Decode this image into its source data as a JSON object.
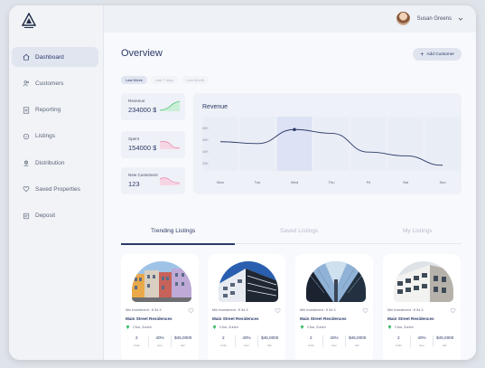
{
  "user": {
    "name": "Susan Greens"
  },
  "sidebar": {
    "items": [
      {
        "label": "Dashboard",
        "icon": "home-icon",
        "active": true
      },
      {
        "label": "Customers",
        "icon": "users-icon",
        "active": false
      },
      {
        "label": "Reporting",
        "icon": "report-icon",
        "active": false
      },
      {
        "label": "Listings",
        "icon": "listings-icon",
        "active": false
      },
      {
        "label": "Distribution",
        "icon": "distribution-icon",
        "active": false
      },
      {
        "label": "Saved Properties",
        "icon": "heart-icon",
        "active": false
      },
      {
        "label": "Deposit",
        "icon": "deposit-icon",
        "active": false
      }
    ]
  },
  "main": {
    "title": "Overview",
    "add_button": "Add Customer",
    "filters": [
      "Last Week",
      "Last 7 days",
      "Last Month"
    ],
    "stats": [
      {
        "label": "Revenue",
        "value": "234000 $",
        "trend_color": "#4cc27a"
      },
      {
        "label": "Spent",
        "value": "154000 $",
        "trend_color": "#e78fb3"
      },
      {
        "label": "New Customers",
        "value": "123",
        "trend_color": "#e78fb3"
      }
    ],
    "tabs": [
      "Trending Listings",
      "Saved Listings",
      "My Listings"
    ]
  },
  "chart_data": {
    "type": "line",
    "title": "Revenue",
    "categories": [
      "Mon",
      "Tue",
      "Wed",
      "Thu",
      "Fri",
      "Sat",
      "Sun"
    ],
    "y_ticks": [
      "80K",
      "60K",
      "40K",
      "20K"
    ],
    "values": [
      62,
      58,
      88,
      80,
      40,
      32,
      12
    ],
    "ylim": [
      0,
      100
    ],
    "highlight_category": "Wed",
    "line_color": "#2b3a67"
  },
  "listings": [
    {
      "min_investment": "Min Investment : ¥ 54.3",
      "name": "Main Street Residences",
      "location": "Chur, Zurich",
      "metrics": [
        {
          "value": "2",
          "label": "Units"
        },
        {
          "value": "40%",
          "label": "Gen"
        },
        {
          "value": "$45,0000",
          "label": "Etc"
        }
      ]
    },
    {
      "min_investment": "Min Investment : ¥ 54.3",
      "name": "Main Street Residences",
      "location": "Chur, Zurich",
      "metrics": [
        {
          "value": "2",
          "label": "Units"
        },
        {
          "value": "40%",
          "label": "Gen"
        },
        {
          "value": "$45,0000",
          "label": "Etc"
        }
      ]
    },
    {
      "min_investment": "Min Investment : ¥ 54.3",
      "name": "Main Street Residences",
      "location": "Chur, Zurich",
      "metrics": [
        {
          "value": "2",
          "label": "Units"
        },
        {
          "value": "40%",
          "label": "Gen"
        },
        {
          "value": "$45,0000",
          "label": "Etc"
        }
      ]
    },
    {
      "min_investment": "Min Investment : ¥ 54.3",
      "name": "Main Street Residences",
      "location": "Chur, Zurich",
      "metrics": [
        {
          "value": "2",
          "label": "Units"
        },
        {
          "value": "40%",
          "label": "Gen"
        },
        {
          "value": "$45,0000",
          "label": "Etc"
        }
      ]
    }
  ]
}
